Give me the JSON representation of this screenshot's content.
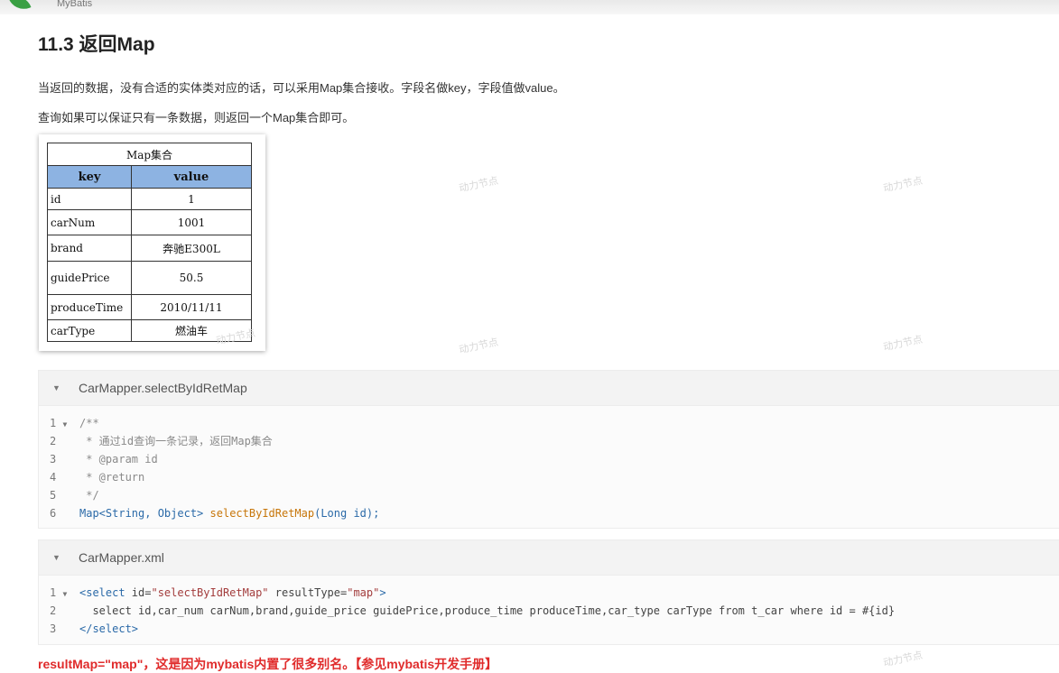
{
  "topbar": {
    "brand": "MyBatis"
  },
  "heading": "11.3 返回Map",
  "paragraphs": [
    "当返回的数据，没有合适的实体类对应的话，可以采用Map集合接收。字段名做key，字段值做value。",
    "查询如果可以保证只有一条数据，则返回一个Map集合即可。"
  ],
  "map_table": {
    "caption": "Map集合",
    "headers": [
      "key",
      "value"
    ],
    "rows": [
      [
        "id",
        "1"
      ],
      [
        "carNum",
        "1001"
      ],
      [
        "brand",
        "奔驰E300L"
      ],
      [
        "guidePrice",
        "50.5"
      ],
      [
        "produceTime",
        "2010/11/11"
      ],
      [
        "carType",
        "燃油车"
      ]
    ]
  },
  "watermark": "动力节点",
  "code_blocks": [
    {
      "title": "CarMapper.selectByIdRetMap",
      "lines": [
        "1",
        "2",
        "3",
        "4",
        "5",
        "6"
      ],
      "code": {
        "l1": "/**",
        "l2": " * 通过id查询一条记录，返回Map集合",
        "l3": " * @param id",
        "l4": " * @return",
        "l5": " */",
        "l6_type": "Map<String, Object>",
        "l6_fn": "selectByIdRetMap",
        "l6_param": "(Long id);"
      }
    },
    {
      "title": "CarMapper.xml",
      "lines": [
        "1",
        "2",
        "3"
      ],
      "code": {
        "l1_open": "<select",
        "l1_attr1": " id=",
        "l1_val1": "\"selectByIdRetMap\"",
        "l1_attr2": " resultType=",
        "l1_val2": "\"map\"",
        "l1_close": ">",
        "l2": "  select id,car_num carNum,brand,guide_price guidePrice,produce_time produceTime,car_type carType from t_car where id = #{id}",
        "l3": "</select>"
      }
    }
  ],
  "bottom_note": "resultMap=\"map\"，这是因为mybatis内置了很多别名。【参见mybatis开发手册】",
  "colors": {
    "table_header": "#8db3e2",
    "note_red": "#e02b2b",
    "accent_green": "#3aa043"
  }
}
